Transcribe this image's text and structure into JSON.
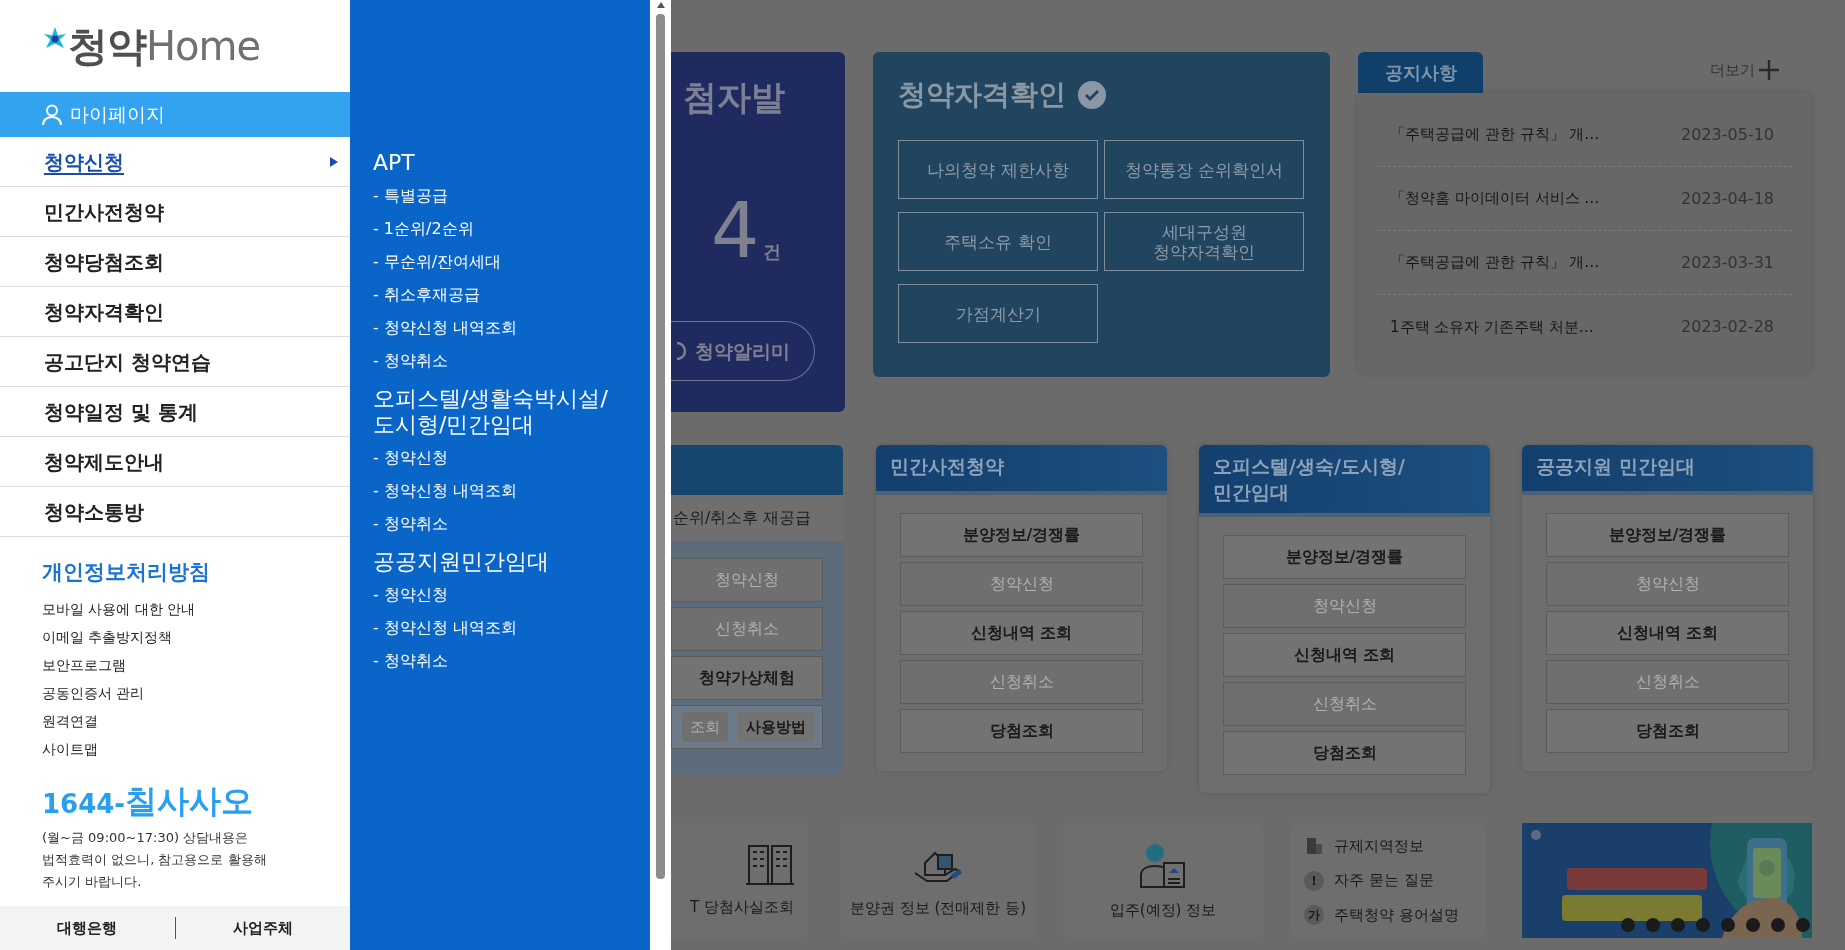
{
  "sidebar": {
    "logo": {
      "mark": "청약",
      "word": "Home"
    },
    "mypage": "마이페이지",
    "menu": [
      {
        "label": "청약신청",
        "selected": true
      },
      {
        "label": "민간사전청약",
        "selected": false
      },
      {
        "label": "청약당첨조회",
        "selected": false
      },
      {
        "label": "청약자격확인",
        "selected": false
      },
      {
        "label": "공고단지 청약연습",
        "selected": false
      },
      {
        "label": "청약일정 및 통계",
        "selected": false
      },
      {
        "label": "청약제도안내",
        "selected": false
      },
      {
        "label": "청약소통방",
        "selected": false
      }
    ],
    "policy": {
      "title": "개인정보처리방침",
      "links": [
        "모바일 사용에 대한 안내",
        "이메일 추출방지정책",
        "보안프로그램",
        "공동인증서 관리",
        "원격연결",
        "사이트맵"
      ]
    },
    "phone": {
      "prefix": "1644-",
      "word": "칠사사오"
    },
    "hours": "(월~금 09:00~17:30) 상담내용은 법적효력이 없으니, 참고용으로 활용해 주시기 바랍니다.",
    "footer": [
      "대행은행",
      "사업주체"
    ]
  },
  "submenu": {
    "groups": [
      {
        "title": "APT",
        "items": [
          "- 특별공급",
          "- 1순위/2순위",
          "- 무순위/잔여세대",
          "- 취소후재공급",
          "- 청약신청 내역조회",
          "- 청약취소"
        ]
      },
      {
        "title": "오피스텔/생활숙박시설/도시형/민간임대",
        "items": [
          "- 청약신청",
          "- 청약신청 내역조회",
          "- 청약취소"
        ]
      },
      {
        "title": "공공지원민간임대",
        "items": [
          "- 청약신청",
          "- 청약신청 내역조회",
          "- 청약취소"
        ]
      }
    ]
  },
  "winners_card": {
    "title": "첨자발",
    "count": "4",
    "unit": "건",
    "button": "청약알리미"
  },
  "eligibility": {
    "title": "청약자격확인",
    "buttons": [
      "나의청약 제한사항",
      "청약통장 순위확인서",
      "주택소유 확인",
      "세대구성원 청약자격확인",
      "가점계산기"
    ]
  },
  "notices": {
    "tab": "공지사항",
    "more": "더보기",
    "rows": [
      {
        "title": "「주택공급에 관한 규칙」 개…",
        "date": "2023-05-10"
      },
      {
        "title": "「청약홈 마이데이터 서비스 …",
        "date": "2023-04-18"
      },
      {
        "title": "「주택공급에 관한 규칙」 개…",
        "date": "2023-03-31"
      },
      {
        "title": "1주택 소유자 기존주택 처분…",
        "date": "2023-02-28"
      }
    ]
  },
  "apt_card": {
    "subtitle": "순위/취소후 재공급",
    "buttons": [
      {
        "label": "청약신청",
        "disabled": true
      },
      {
        "label": "신청취소",
        "disabled": true
      },
      {
        "label": "청약가상체험",
        "disabled": false
      }
    ],
    "small_buttons": [
      {
        "label": "조회",
        "disabled": true
      },
      {
        "label": "사용방법",
        "disabled": false
      }
    ]
  },
  "service_cards": [
    {
      "title": "민간사전청약",
      "buttons": [
        {
          "label": "분양정보/경쟁률",
          "disabled": false
        },
        {
          "label": "청약신청",
          "disabled": true
        },
        {
          "label": "신청내역 조회",
          "disabled": false
        },
        {
          "label": "신청취소",
          "disabled": true
        },
        {
          "label": "당첨조회",
          "disabled": false
        }
      ]
    },
    {
      "title": "오피스텔/생숙/도시형/민간임대",
      "buttons": [
        {
          "label": "분양정보/경쟁률",
          "disabled": false
        },
        {
          "label": "청약신청",
          "disabled": true
        },
        {
          "label": "신청내역 조회",
          "disabled": false
        },
        {
          "label": "신청취소",
          "disabled": true
        },
        {
          "label": "당첨조회",
          "disabled": false
        }
      ]
    },
    {
      "title": "공공지원 민간임대",
      "buttons": [
        {
          "label": "분양정보/경쟁률",
          "disabled": false
        },
        {
          "label": "청약신청",
          "disabled": true
        },
        {
          "label": "신청내역 조회",
          "disabled": false
        },
        {
          "label": "신청취소",
          "disabled": true
        },
        {
          "label": "당첨조회",
          "disabled": false
        }
      ]
    }
  ],
  "quick_links": [
    {
      "kind": "buildings",
      "label": "T 당첨사실조회"
    },
    {
      "kind": "hand-house",
      "label": "분양권 정보 (전매제한 등)"
    },
    {
      "kind": "resident",
      "label": "입주(예정) 정보"
    }
  ],
  "links": [
    {
      "kind": "icon",
      "label": "규제지역정보"
    },
    {
      "kind": "glyph",
      "glyph": "!",
      "label": "자주 묻는 질문"
    },
    {
      "kind": "glyph",
      "glyph": "가",
      "label": "주택청약 용어설명"
    }
  ]
}
